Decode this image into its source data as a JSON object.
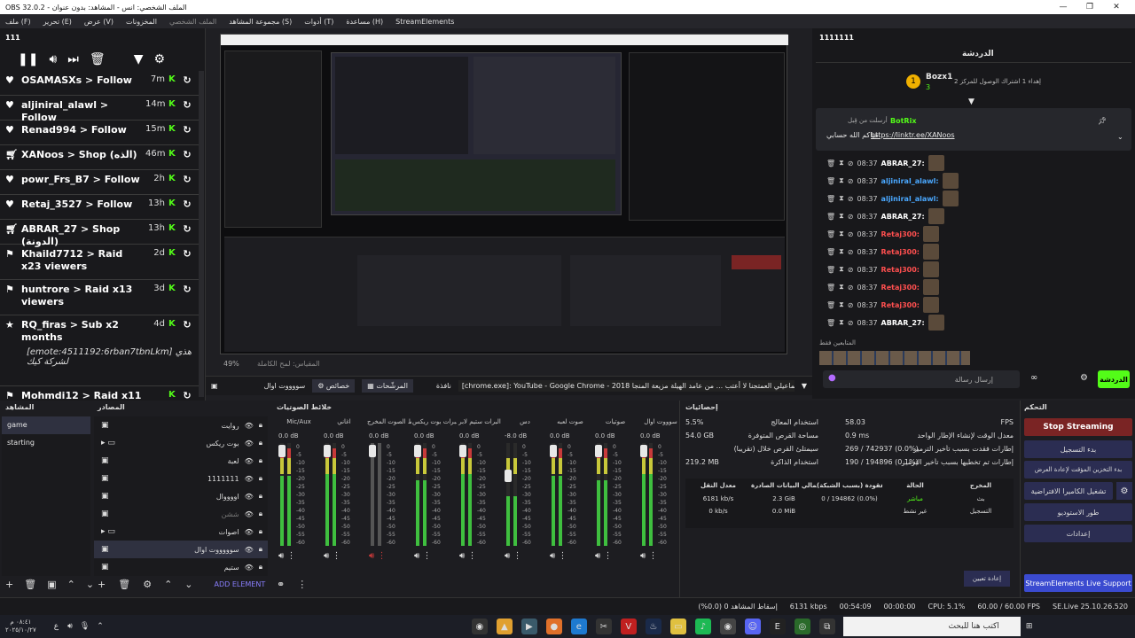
{
  "window": {
    "title": "OBS 32.0.2 - الملف الشخصي: انس - المشاهد: بدون عنوان",
    "min": "—",
    "max": "❐",
    "close": "✕"
  },
  "menu": [
    "ملف (F)",
    "تحرير (E)",
    "عرض (V)",
    "المخزونات",
    "الملف الشخصي",
    "مجموعة المشاهد (S)",
    "أدوات (T)",
    "مساعدة (H)",
    "StreamElements"
  ],
  "activity": {
    "title": "111",
    "items": [
      {
        "icon": "heart",
        "text": "OSAMASXs > Follow",
        "time": "7m"
      },
      {
        "icon": "heart",
        "text": "aljiniral_alawl > Follow",
        "time": "14m"
      },
      {
        "icon": "heart",
        "text": "Renad994 > Follow",
        "time": "15m"
      },
      {
        "icon": "cart",
        "text": "XANoos > Shop (الذه)",
        "time": "46m"
      },
      {
        "icon": "heart",
        "text": "powr_Frs_B7 > Follow",
        "time": "2h"
      },
      {
        "icon": "heart",
        "text": "Retaj_3527 > Follow",
        "time": "13h"
      },
      {
        "icon": "cart",
        "text": "ABRAR_27 > Shop (الدونة)",
        "time": "13h"
      },
      {
        "icon": "raid",
        "text": "Khaild7712 > Raid x23 viewers",
        "time": "2d"
      },
      {
        "icon": "raid",
        "text": "huntrore > Raid x13 viewers",
        "time": "3d"
      },
      {
        "icon": "star",
        "text": "RQ_firas > Sub x2 months",
        "sub": "[emote:4511192:6rban7tbnLkm] هذي لشركة كيك",
        "time": "4d"
      },
      {
        "icon": "raid",
        "text": "Mohmdi12 > Raid x11",
        "time": ""
      }
    ]
  },
  "preview": {
    "zoom": "49%",
    "hint": "المقياس: لمح الكاملة"
  },
  "scene_bar": {
    "window_title": "[chrome.exe]: YouTube - Google Chrome - 2018 فهد بن فصلاء / الاسماعيلي العمتجنا لا أعتب ... من عامد الهيلة مزيعة المنجا",
    "btn_window": "نافذة",
    "btn_filters": "المرشّحات",
    "btn_properties": "خصائص",
    "source_name": "سووووت اوال"
  },
  "chat": {
    "title": "الدردشة",
    "panel_title": "1111111",
    "pinned_user": "Bozx1",
    "pinned_text": "إهداء 1 اشتراك الوصول للمركز 2",
    "pinned_num": "3",
    "bot_header": "أرسلت من قِبل",
    "bot_name": "BotRix",
    "bot_msg": "حياكم الله حسابي",
    "bot_link": "https://linktr.ee/XANoos",
    "lines": [
      {
        "time": "08:37",
        "name": "ABRAR_27:",
        "cls": "name-w"
      },
      {
        "time": "08:37",
        "name": "aljiniral_alawl:",
        "cls": "name-b"
      },
      {
        "time": "08:37",
        "name": "aljiniral_alawl:",
        "cls": "name-b"
      },
      {
        "time": "08:37",
        "name": "ABRAR_27:",
        "cls": "name-w"
      },
      {
        "time": "08:37",
        "name": "Retaj300:",
        "cls": "name-r"
      },
      {
        "time": "08:37",
        "name": "Retaj300:",
        "cls": "name-r"
      },
      {
        "time": "08:37",
        "name": "Retaj300:",
        "cls": "name-r"
      },
      {
        "time": "08:37",
        "name": "Retaj300:",
        "cls": "name-r"
      },
      {
        "time": "08:37",
        "name": "Retaj300:",
        "cls": "name-r"
      },
      {
        "time": "08:37",
        "name": "ABRAR_27:",
        "cls": "name-w"
      }
    ],
    "viewers_label": "المتابعين فقط",
    "input_placeholder": "إرسال رسالة",
    "chat_button": "الدردشة"
  },
  "scenes": {
    "title": "المشاهد",
    "items": [
      "game",
      "starting"
    ]
  },
  "sources": {
    "title": "المصادر",
    "items": [
      "روايت",
      "بوت ريكس",
      "لعبة",
      "1111111",
      "اووووال",
      "ششن",
      "اصوات",
      "سوووووت اوال",
      "ستيم"
    ],
    "add_label": "ADD ELEMENT"
  },
  "mixer": {
    "title": "خلائط الصوتيات",
    "channels": [
      {
        "name": "Mic/Aux",
        "db": "0.0 dB"
      },
      {
        "name": "اغاني",
        "db": "0.0 dB"
      },
      {
        "name": "التقاط الصوت المخرج",
        "db": "0.0 dB"
      },
      {
        "name": "البرات بوت ريكس",
        "db": "0.0 dB"
      },
      {
        "name": "البرات ستيم لابر",
        "db": "0.0 dB"
      },
      {
        "name": "دس",
        "db": "-8.0 dB"
      },
      {
        "name": "صوت لعبه",
        "db": "0.0 dB"
      },
      {
        "name": "صوتيات",
        "db": "0.0 dB"
      },
      {
        "name": "سوووت اوال",
        "db": "0.0 dB"
      }
    ],
    "scale": [
      "0",
      "-5",
      "-10",
      "-15",
      "-20",
      "-25",
      "-30",
      "-35",
      "-40",
      "-45",
      "-50",
      "-55",
      "-60"
    ]
  },
  "stats": {
    "title": "إحصائيات",
    "rows": [
      {
        "l": "استخدام المعالج",
        "v": "5.5%",
        "l2": "FPS",
        "v2": "58.03"
      },
      {
        "l": "مساحة القرص المتوفرة",
        "v": "54.0 GB",
        "l2": "معدل الوقت لإنشاء الإطار الواحد",
        "v2": "0.9 ms"
      },
      {
        "l": "سيمتلئ القرص خلال (تقريبا)",
        "v": "",
        "l2": "إطارات فقدت بسبب تأخير الترميز",
        "v2": "269 / 742937 (0.0%)"
      },
      {
        "l": "استخدام الذاكرة",
        "v": "219.2 MB",
        "l2": "إطارات تم تخطيها بسبب تأخير الترميز",
        "v2": "190 / 194896 (0.1%)"
      }
    ],
    "table_head": [
      "معدل النقل",
      "إجمالي البيانات الصادرة",
      "الإطارات المفقودة (بسبب الشبكة)",
      "الحالة",
      "المخرج"
    ],
    "table_rows": [
      {
        "rate": "6181 kb/s",
        "total": "2.3 GiB",
        "dropped": "0 / 194862 (0.0%)",
        "status": "مباشر",
        "out": "بث"
      },
      {
        "rate": "0 kb/s",
        "total": "0.0 MiB",
        "dropped": "",
        "status": "غير نشط",
        "out": "التسجيل"
      }
    ],
    "reset": "إعادة تعيين"
  },
  "controls": {
    "title": "التحكم",
    "stop": "Stop Streaming",
    "record": "بدء التسجيل",
    "buffer": "بدء التخزين المؤقت لإعادة العرض",
    "vcam": "تشغيل الكاميرا الافتراضية",
    "studio": "طور الاستوديو",
    "settings": "إعدادات",
    "se_support": "StreamElements Live Support"
  },
  "status": {
    "dropped": "إسقاط المشاهد 0 (0.0%)",
    "kbps": "6131 kbps",
    "time": "00:54:09",
    "rec": "00:00:00",
    "cpu": "CPU: 5.1%",
    "fps": "60.00 / 60.00 FPS",
    "ver": "SE.Live 25.10.26.520"
  },
  "taskbar": {
    "search": "اكتب هنا للبحث",
    "clock_time": "٠٨:٤١ م",
    "clock_date": "٢٠٢٥/١٠/٢٧"
  },
  "colors": {
    "accent": "#53fc18",
    "stop": "#7a2424",
    "ctrl": "#2b2d52",
    "se": "#3b4bd0"
  }
}
